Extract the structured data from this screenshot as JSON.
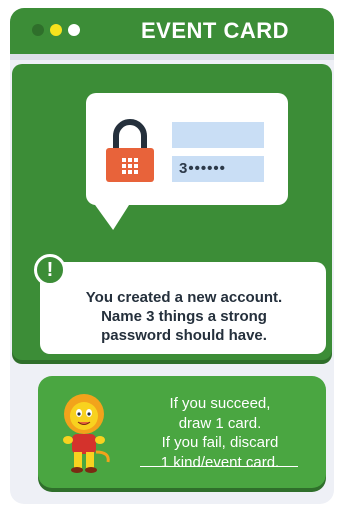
{
  "header": {
    "title": "EVENT CARD",
    "dot_colors": [
      "#2f6f2b",
      "#f6e21d",
      "#ffffff"
    ]
  },
  "scene": {
    "password_field_value": "3••••••"
  },
  "prompt": {
    "alert_symbol": "!",
    "lines": [
      "You created a new account.",
      "Name 3 things a strong",
      "password should have."
    ]
  },
  "outcome": {
    "lines": [
      "If you succeed,",
      "draw 1 card.",
      "If you fail, discard",
      "1 kind/event card."
    ]
  },
  "icons": [
    "padlock-icon",
    "alert-icon",
    "lion-mascot-icon"
  ],
  "colors": {
    "green": "#3c8d37",
    "light_green": "#4aa641",
    "lock_orange": "#e8633a"
  }
}
